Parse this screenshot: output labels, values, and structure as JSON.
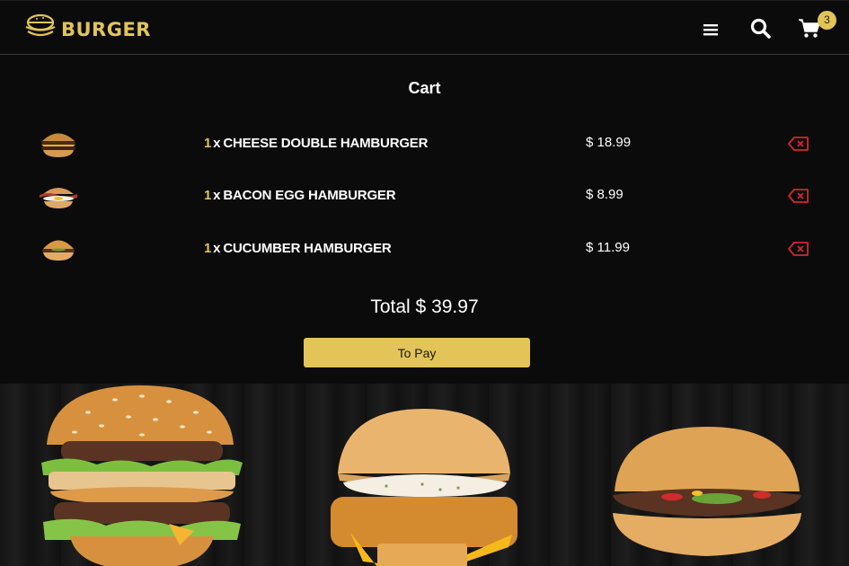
{
  "header": {
    "brand": "BURGER",
    "brand_icon": "burger-logo-icon",
    "menu_icon": "hamburger-menu-icon",
    "search_icon": "search-icon",
    "cart_icon": "shopping-cart-icon",
    "cart_count": "3"
  },
  "cart": {
    "title": "Cart",
    "items": [
      {
        "qty": "1",
        "sep": "x",
        "name": "CHEESE DOUBLE HAMBURGER",
        "price": "$ 18.99",
        "thumb": "cheese-double-burger-image",
        "remove_icon": "remove-icon"
      },
      {
        "qty": "1",
        "sep": "x",
        "name": "BACON EGG HAMBURGER",
        "price": "$ 8.99",
        "thumb": "bacon-egg-burger-image",
        "remove_icon": "remove-icon"
      },
      {
        "qty": "1",
        "sep": "x",
        "name": "CUCUMBER HAMBURGER",
        "price": "$ 11.99",
        "thumb": "cucumber-burger-image",
        "remove_icon": "remove-icon"
      }
    ],
    "total": "Total $ 39.97",
    "pay_label": "To Pay"
  },
  "gallery": {
    "items": [
      "big-double-burger-image",
      "fish-burger-image",
      "classic-burger-image"
    ]
  },
  "colors": {
    "accent": "#e2c458",
    "background": "#0b0b0c",
    "danger": "#d0282c"
  }
}
